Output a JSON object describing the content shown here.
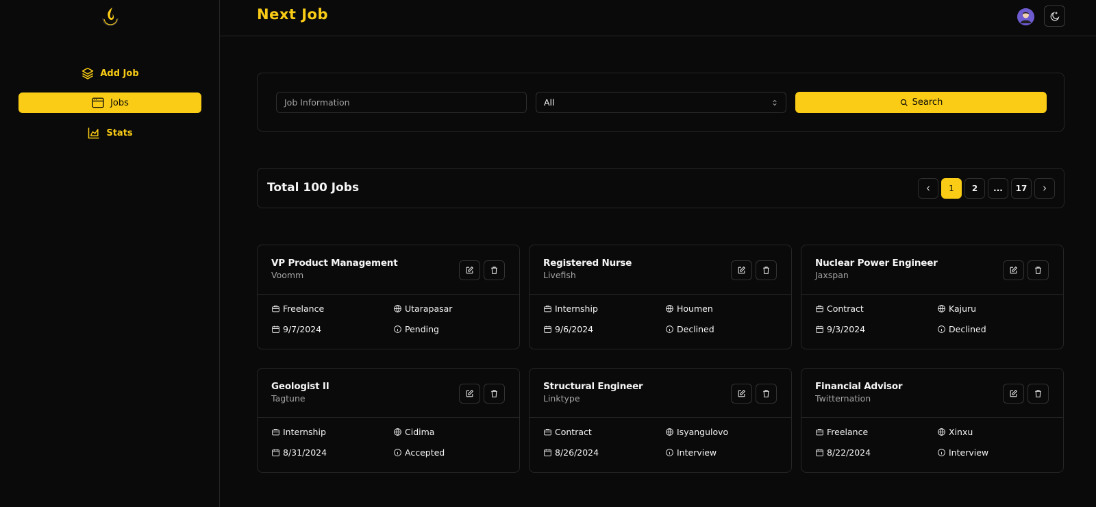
{
  "app": {
    "brand": "Next Job"
  },
  "colors": {
    "accent": "#facc15",
    "background": "#0a0a0a",
    "border": "#262626"
  },
  "sidebar": {
    "logo_icon": "flame-logo",
    "items": [
      {
        "label": "Add Job",
        "icon": "layers-icon",
        "active": false
      },
      {
        "label": "Jobs",
        "icon": "browser-window-icon",
        "active": true
      },
      {
        "label": "Stats",
        "icon": "area-chart-icon",
        "active": false
      }
    ]
  },
  "header": {
    "avatar_icon": "user-avatar",
    "theme_icon": "moon-icon"
  },
  "search": {
    "input_placeholder": "Job Information",
    "status_select_value": "All",
    "button_label": "Search"
  },
  "results": {
    "total_label": "Total 100 Jobs",
    "pagination": {
      "pages": [
        "1",
        "2",
        "...",
        "17"
      ],
      "current": "1"
    }
  },
  "jobs": [
    {
      "title": "VP Product Management",
      "company": "Voomm",
      "type": "Freelance",
      "location": "Utarapasar",
      "date": "9/7/2024",
      "status": "Pending"
    },
    {
      "title": "Registered Nurse",
      "company": "Livefish",
      "type": "Internship",
      "location": "Houmen",
      "date": "9/6/2024",
      "status": "Declined"
    },
    {
      "title": "Nuclear Power Engineer",
      "company": "Jaxspan",
      "type": "Contract",
      "location": "Kajuru",
      "date": "9/3/2024",
      "status": "Declined"
    },
    {
      "title": "Geologist II",
      "company": "Tagtune",
      "type": "Internship",
      "location": "Cidima",
      "date": "8/31/2024",
      "status": "Accepted"
    },
    {
      "title": "Structural Engineer",
      "company": "Linktype",
      "type": "Contract",
      "location": "Isyangulovo",
      "date": "8/26/2024",
      "status": "Interview"
    },
    {
      "title": "Financial Advisor",
      "company": "Twitternation",
      "type": "Freelance",
      "location": "Xinxu",
      "date": "8/22/2024",
      "status": "Interview"
    }
  ]
}
